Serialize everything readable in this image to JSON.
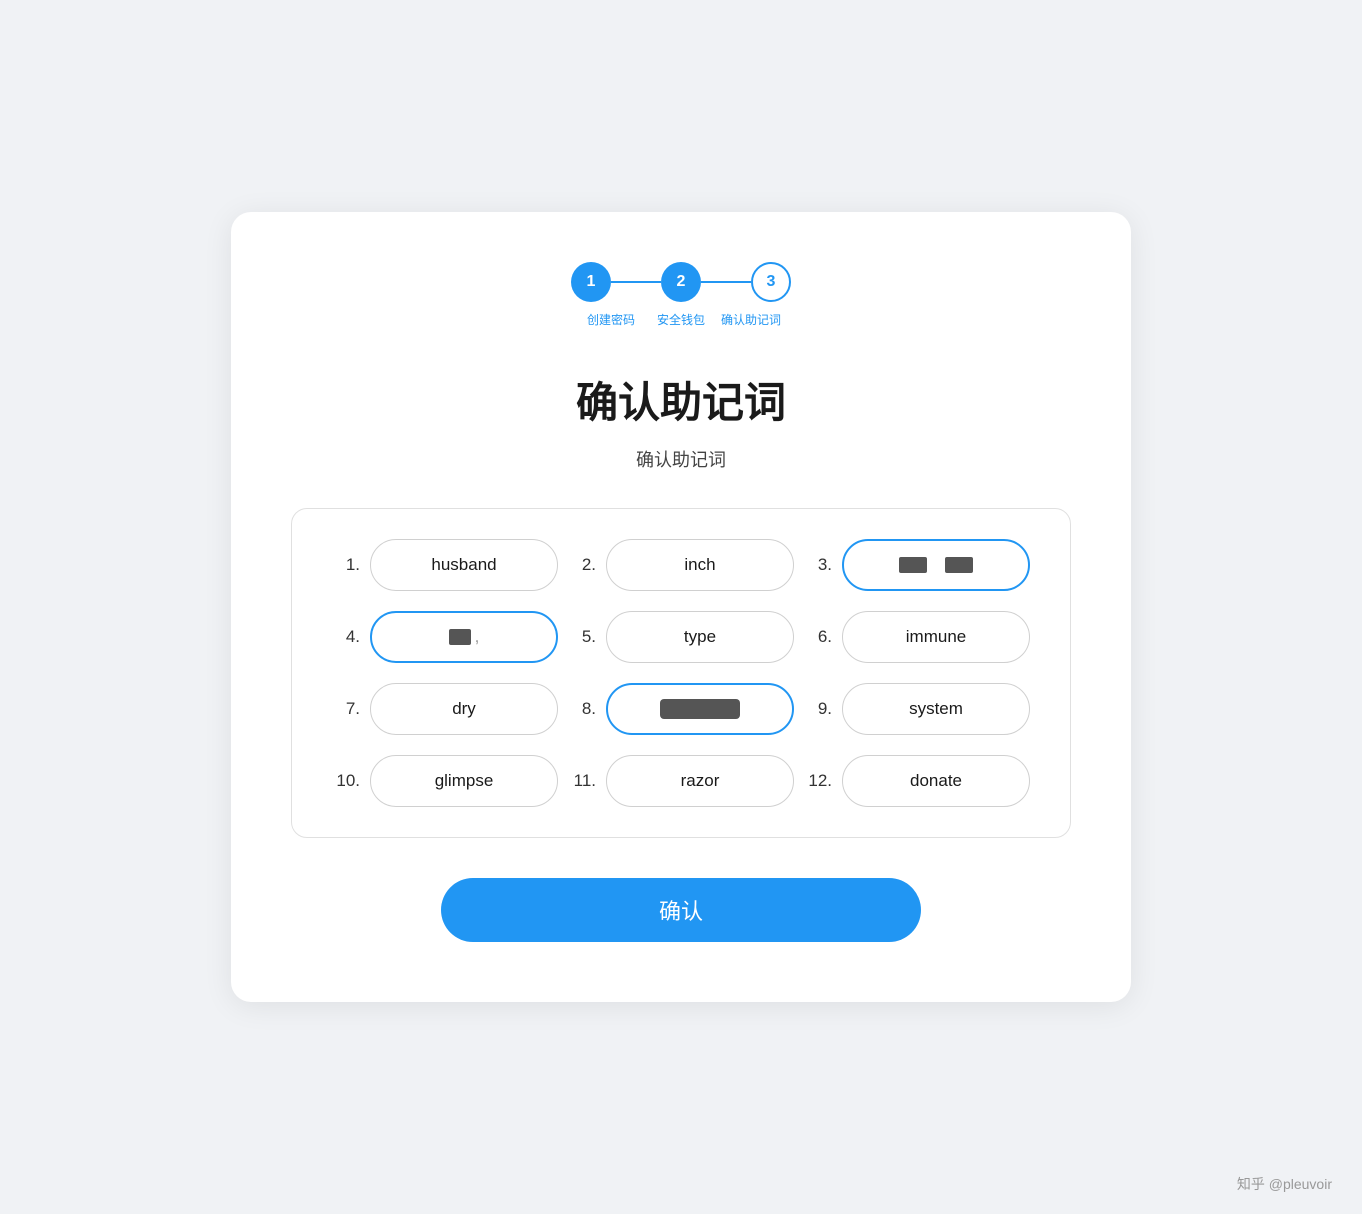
{
  "stepper": {
    "steps": [
      {
        "number": "1",
        "label": "创建密码",
        "state": "active"
      },
      {
        "number": "2",
        "label": "安全钱包",
        "state": "active"
      },
      {
        "number": "3",
        "label": "确认助记词",
        "state": "outline"
      }
    ]
  },
  "page": {
    "title": "确认助记词",
    "subtitle": "确认助记词",
    "confirm_button": "确认"
  },
  "words": [
    {
      "number": "1.",
      "word": "husband",
      "state": "normal",
      "blurred": false
    },
    {
      "number": "2.",
      "word": "inch",
      "state": "normal",
      "blurred": false
    },
    {
      "number": "3.",
      "word": "",
      "state": "selected",
      "blurred": true,
      "blur_type": "two_blocks"
    },
    {
      "number": "4.",
      "word": "",
      "state": "selected",
      "blurred": true,
      "blur_type": "one_block"
    },
    {
      "number": "5.",
      "word": "type",
      "state": "normal",
      "blurred": false
    },
    {
      "number": "6.",
      "word": "immune",
      "state": "normal",
      "blurred": false
    },
    {
      "number": "7.",
      "word": "dry",
      "state": "normal",
      "blurred": false
    },
    {
      "number": "8.",
      "word": "",
      "state": "selected",
      "blurred": true,
      "blur_type": "bar"
    },
    {
      "number": "9.",
      "word": "system",
      "state": "normal",
      "blurred": false
    },
    {
      "number": "10.",
      "word": "glimpse",
      "state": "normal",
      "blurred": false
    },
    {
      "number": "11.",
      "word": "razor",
      "state": "normal",
      "blurred": false
    },
    {
      "number": "12.",
      "word": "donate",
      "state": "normal",
      "blurred": false
    }
  ],
  "watermark": {
    "text": "知乎 @pleuvoir"
  }
}
